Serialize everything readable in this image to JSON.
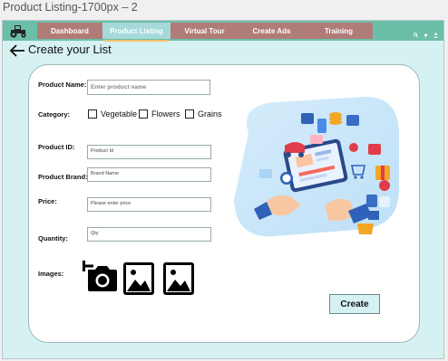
{
  "window": {
    "title": "Product Listing-1700px – 2"
  },
  "nav": {
    "tabs": [
      {
        "label": "Dashboard"
      },
      {
        "label": "Product Listing"
      },
      {
        "label": "Virtual Tour"
      },
      {
        "label": "Create Ads"
      },
      {
        "label": "Training"
      }
    ],
    "active_tab": "Product Listing",
    "icons": [
      "search-icon",
      "bell-icon",
      "user-icon"
    ]
  },
  "page": {
    "title": "Create your List"
  },
  "form": {
    "product_name": {
      "label": "Product Name:",
      "placeholder": "Enter product name"
    },
    "category": {
      "label": "Category:",
      "options": [
        {
          "label": "Vegetable",
          "checked": false
        },
        {
          "label": "Flowers",
          "checked": false
        },
        {
          "label": "Grains",
          "checked": false
        }
      ]
    },
    "product_id": {
      "label": "Product ID:",
      "placeholder": "Product Id"
    },
    "product_brand": {
      "label": "Product Brand:",
      "placeholder": "Brand Name"
    },
    "price": {
      "label": "Price:",
      "placeholder": "Please enter price"
    },
    "quantity": {
      "label": "Quantity:",
      "placeholder": "Qty"
    },
    "images": {
      "label": "Images:",
      "icons": [
        "add-photo-icon",
        "image-icon",
        "image-icon"
      ]
    },
    "create_label": "Create"
  },
  "colors": {
    "navbar": "#6bbfa9",
    "tab": "#b07c78",
    "active_tab": "#a5d9da",
    "background": "#d6f1f2"
  }
}
